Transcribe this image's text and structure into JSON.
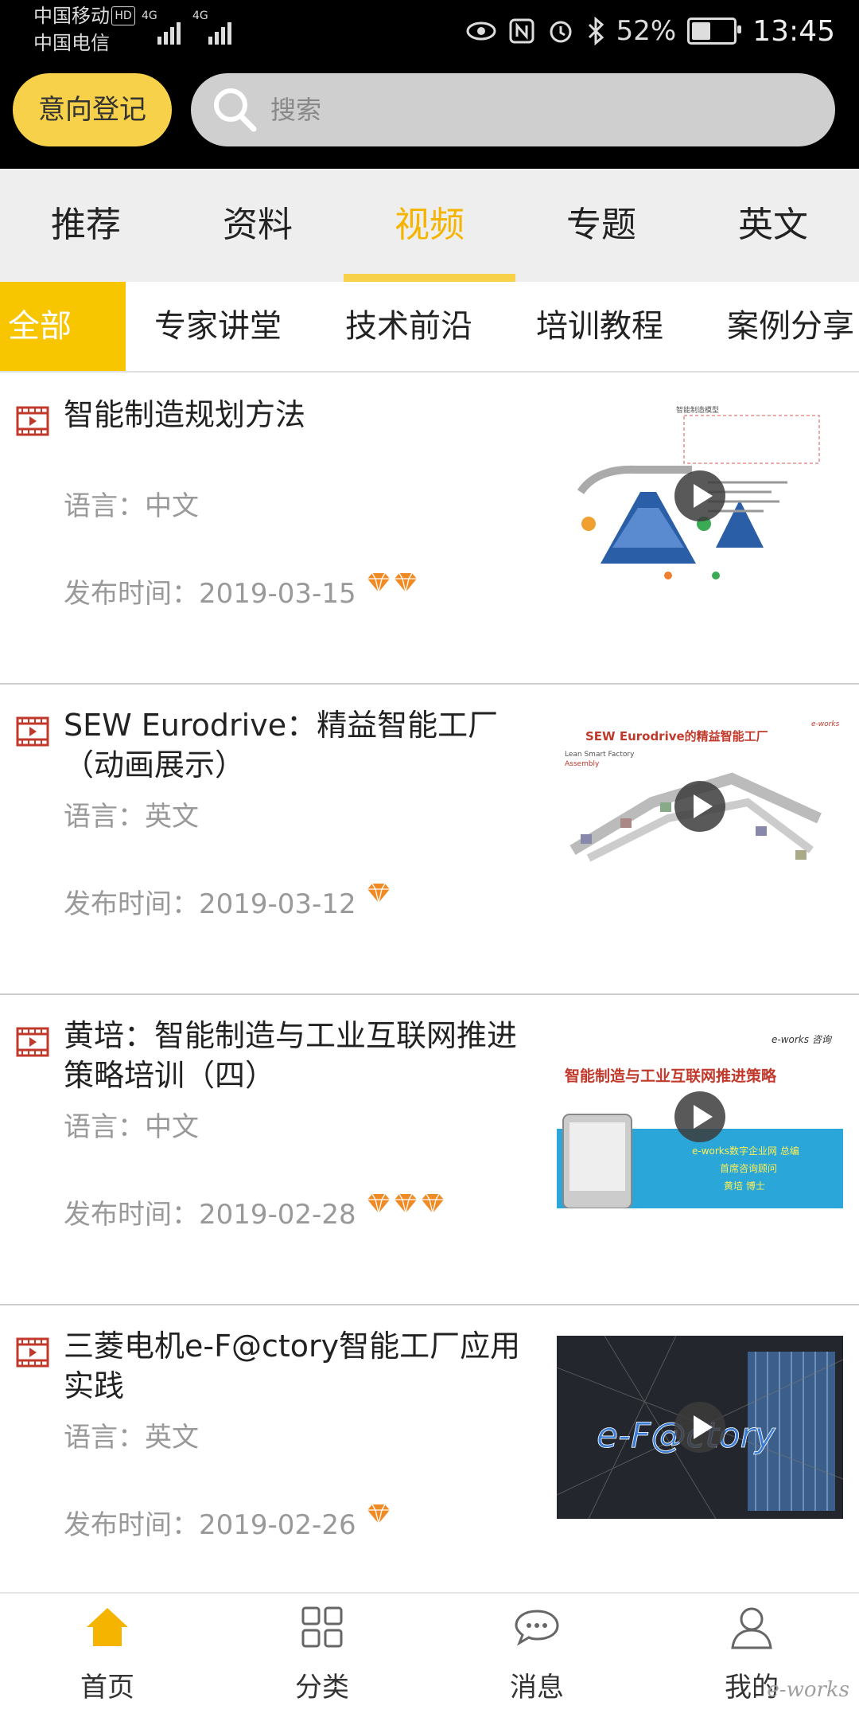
{
  "status_bar": {
    "carrier1": "中国移动",
    "hd": "HD",
    "carrier2": "中国电信",
    "net1": "4G",
    "net2": "4G",
    "battery_pct": "52%",
    "battery_level": 0.52,
    "time": "13:45",
    "icons": [
      "eye-icon",
      "nfc-icon",
      "alarm-icon",
      "bluetooth-icon"
    ]
  },
  "header": {
    "register_label": "意向登记",
    "search_placeholder": "搜索"
  },
  "tabs": [
    {
      "label": "推荐"
    },
    {
      "label": "资料"
    },
    {
      "label": "视频",
      "active": true
    },
    {
      "label": "专题"
    },
    {
      "label": "英文"
    }
  ],
  "subtabs": [
    {
      "label": "全部",
      "active": true
    },
    {
      "label": "专家讲堂"
    },
    {
      "label": "技术前沿"
    },
    {
      "label": "培训教程"
    },
    {
      "label": "案例分享"
    }
  ],
  "items": [
    {
      "title": "智能制造规划方法",
      "lang": "语言：中文",
      "date": "发布时间：2019-03-15",
      "gems": 2,
      "thumb_texts": [
        "智能制造模型"
      ]
    },
    {
      "title": "SEW Eurodrive：精益智能工厂（动画展示）",
      "lang": "语言：英文",
      "date": "发布时间：2019-03-12",
      "gems": 1,
      "thumb_texts": [
        "SEW Eurodrive的精益智能工厂",
        "Lean Smart Factory",
        "Assembly",
        "e-works"
      ]
    },
    {
      "title": "黄培：智能制造与工业互联网推进策略培训（四）",
      "lang": "语言：中文",
      "date": "发布时间：2019-02-28",
      "gems": 3,
      "thumb_texts": [
        "e-works 咨询",
        "智能制造与工业互联网推进策略",
        "e-works数字企业网 总编",
        "首席咨询顾问",
        "黄培  博士"
      ]
    },
    {
      "title": "三菱电机e-F@ctory智能工厂应用实践",
      "lang": "语言：英文",
      "date": "发布时间：2019-02-26",
      "gems": 1,
      "thumb_texts": [
        "e-F@ctory"
      ]
    }
  ],
  "bottom_nav": [
    {
      "label": "首页",
      "icon": "home-icon",
      "active": true
    },
    {
      "label": "分类",
      "icon": "grid-icon"
    },
    {
      "label": "消息",
      "icon": "message-icon"
    },
    {
      "label": "我的",
      "icon": "user-icon"
    }
  ],
  "watermark": "e-works",
  "colors": {
    "accent": "#f7c600",
    "active_tab": "#f4b400",
    "register_btn": "#f7d149",
    "video_icon": "#c0392b",
    "gem": "#f08a24"
  }
}
